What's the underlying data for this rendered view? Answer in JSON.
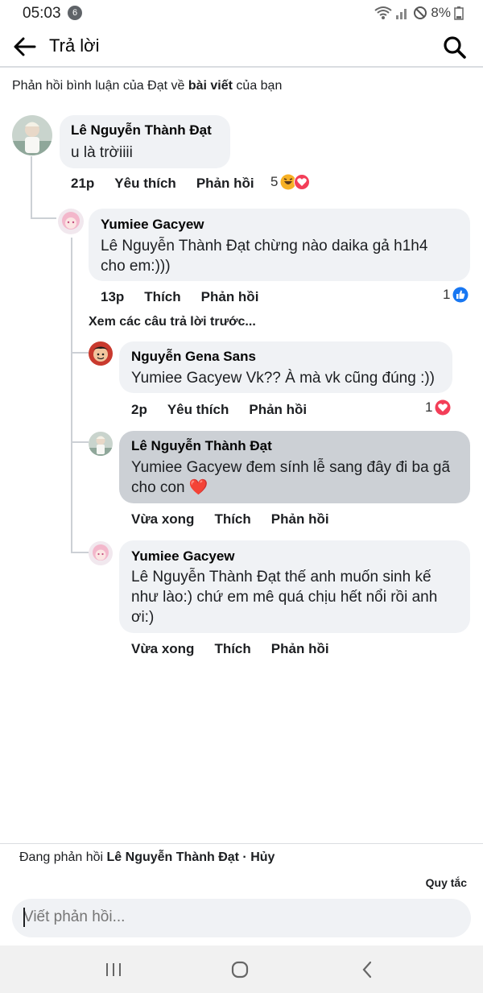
{
  "status_bar": {
    "time": "05:03",
    "notif_count": "6",
    "battery": "8%"
  },
  "header": {
    "title": "Trả lời"
  },
  "context": {
    "prefix": "Phản hồi bình luận của Đạt về ",
    "bold": "bài viết",
    "suffix": " của bạn"
  },
  "comments": [
    {
      "name": "Lê Nguyễn Thành Đạt",
      "text": "u là trờiiii",
      "time": "21p",
      "like": "Yêu thích",
      "reply": "Phản hồi",
      "reactions": "5"
    },
    {
      "name": "Yumiee Gacyew",
      "text": "Lê Nguyễn Thành Đạt chừng nào daika gả h1h4 cho em:)))",
      "time": "13p",
      "like": "Thích",
      "reply": "Phản hồi",
      "reactions": "1"
    },
    {
      "name": "Nguyễn Gena Sans",
      "text": "Yumiee Gacyew Vk?? À mà vk cũng đúng :))",
      "time": "2p",
      "like": "Yêu thích",
      "reply": "Phản hồi",
      "reactions": "1"
    },
    {
      "name": "Lê Nguyễn Thành Đạt",
      "text": "Yumiee Gacyew đem sính lễ sang đây đi ba gã cho con ❤️",
      "time": "Vừa xong",
      "like": "Thích",
      "reply": "Phản hồi"
    },
    {
      "name": "Yumiee Gacyew",
      "text": "Lê Nguyễn Thành Đạt thế anh muốn sinh kế như lào:) chứ em mê quá chịu hết nổi rồi anh ơi:)",
      "time": "Vừa xong",
      "like": "Thích",
      "reply": "Phản hồi"
    }
  ],
  "view_previous": "Xem các câu trả lời trước...",
  "footer": {
    "replying_prefix": "Đang phản hồi ",
    "replying_name": "Lê Nguyễn Thành Đạt",
    "replying_cancel": " · Hủy",
    "rules": "Quy tắc",
    "composer_placeholder": "Viết phản hồi..."
  },
  "colors": {
    "like_blue": "#1877f2",
    "love_red": "#f33e58",
    "bubble": "#f0f2f5",
    "bubble_highlight": "#ccd0d5"
  }
}
